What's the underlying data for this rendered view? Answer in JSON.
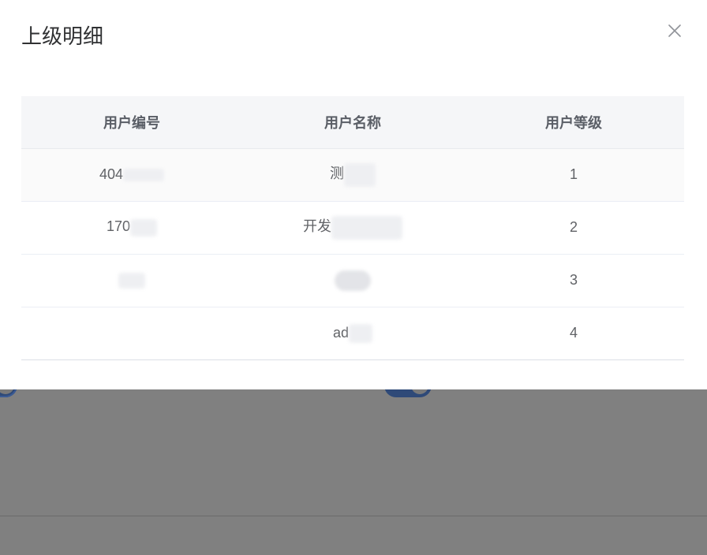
{
  "dialog": {
    "title": "上级明细"
  },
  "table": {
    "columns": [
      "用户编号",
      "用户名称",
      "用户等级"
    ],
    "rows": [
      {
        "user_id": "404",
        "user_name": "测",
        "user_level": "1"
      },
      {
        "user_id": "170",
        "user_name": "开发",
        "user_level": "2"
      },
      {
        "user_id": "",
        "user_name": "",
        "user_level": "3"
      },
      {
        "user_id": "",
        "user_name": "ad",
        "user_level": "4"
      }
    ]
  },
  "icons": {
    "close": "close-icon"
  }
}
